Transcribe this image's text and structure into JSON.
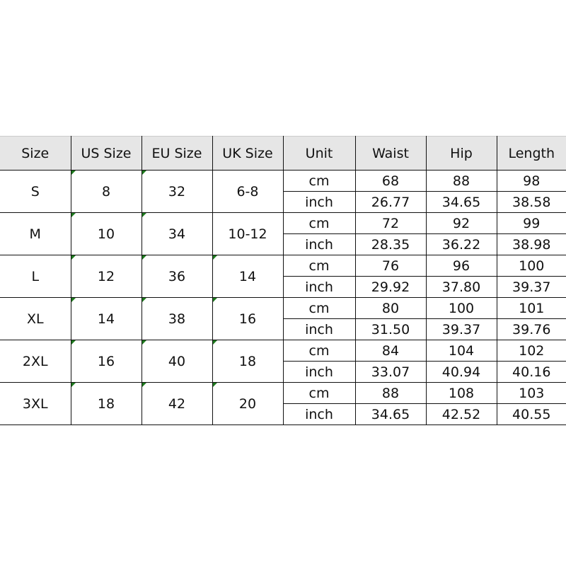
{
  "headers": [
    "Size",
    "US Size",
    "EU Size",
    "UK Size",
    "Unit",
    "Waist",
    "Hip",
    "Length"
  ],
  "indicator_color": "#1e7a1e",
  "rows": [
    {
      "size": "S",
      "us": "8",
      "eu": "32",
      "uk": "6-8",
      "uk_flag": false,
      "cm": [
        "68",
        "88",
        "98"
      ],
      "inch": [
        "26.77",
        "34.65",
        "38.58"
      ]
    },
    {
      "size": "M",
      "us": "10",
      "eu": "34",
      "uk": "10-12",
      "uk_flag": false,
      "cm": [
        "72",
        "92",
        "99"
      ],
      "inch": [
        "28.35",
        "36.22",
        "38.98"
      ]
    },
    {
      "size": "L",
      "us": "12",
      "eu": "36",
      "uk": "14",
      "uk_flag": true,
      "cm": [
        "76",
        "96",
        "100"
      ],
      "inch": [
        "29.92",
        "37.80",
        "39.37"
      ]
    },
    {
      "size": "XL",
      "us": "14",
      "eu": "38",
      "uk": "16",
      "uk_flag": true,
      "cm": [
        "80",
        "100",
        "101"
      ],
      "inch": [
        "31.50",
        "39.37",
        "39.76"
      ]
    },
    {
      "size": "2XL",
      "us": "16",
      "eu": "40",
      "uk": "18",
      "uk_flag": true,
      "cm": [
        "84",
        "104",
        "102"
      ],
      "inch": [
        "33.07",
        "40.94",
        "40.16"
      ]
    },
    {
      "size": "3XL",
      "us": "18",
      "eu": "42",
      "uk": "20",
      "uk_flag": true,
      "cm": [
        "88",
        "108",
        "103"
      ],
      "inch": [
        "34.65",
        "42.52",
        "40.55"
      ]
    }
  ],
  "units": {
    "cm": "cm",
    "inch": "inch"
  }
}
